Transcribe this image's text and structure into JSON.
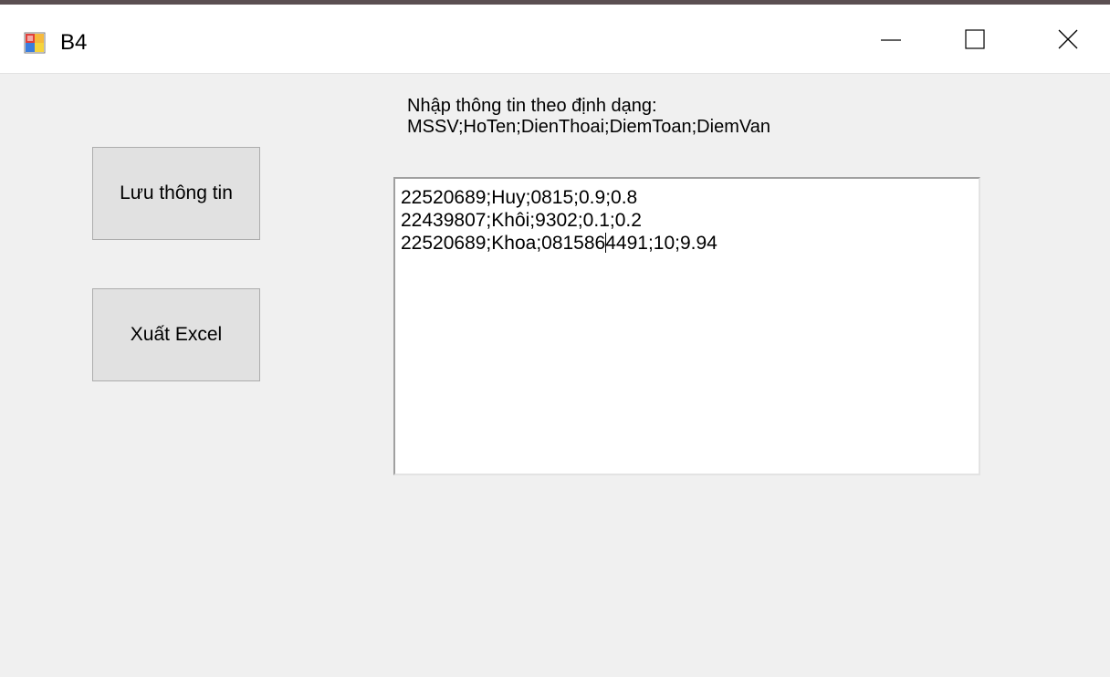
{
  "window": {
    "title": "B4",
    "icon": "winforms-app-icon",
    "controls": {
      "minimize": "minimize-icon",
      "maximize": "maximize-icon",
      "close": "close-icon"
    }
  },
  "buttons": {
    "save_label": "Lưu thông tin",
    "export_label": "Xuất Excel"
  },
  "instruction": {
    "line1": "Nhập thông tin theo định dạng:",
    "line2": "MSSV;HoTen;DienThoai;DiemToan;DiemVan"
  },
  "textbox": {
    "lines": [
      "22520689;Huy;0815;0.9;0.8",
      "22439807;Khôi;9302;0.1;0.2",
      "22520689;Khoa;0815864491;10;9.94"
    ],
    "caret_line3_before": "22520689;Khoa;081586",
    "caret_line3_after": "4491;10;9.94"
  },
  "colors": {
    "window_bg": "#f0f0f0",
    "titlebar_bg": "#ffffff",
    "button_bg": "#e1e1e1",
    "button_border": "#adadad"
  }
}
